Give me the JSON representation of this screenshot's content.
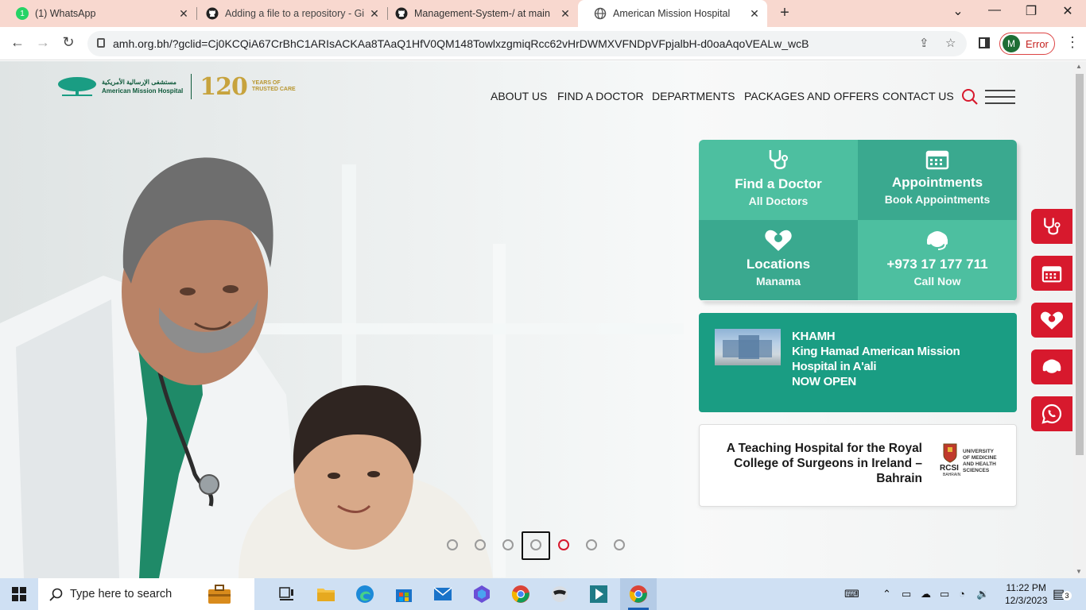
{
  "browser": {
    "tabs": [
      {
        "title": "(1) WhatsApp",
        "icon": "whatsapp-icon"
      },
      {
        "title": "Adding a file to a repository - Gi",
        "icon": "github-icon"
      },
      {
        "title": "Management-System-/ at main",
        "icon": "github-icon"
      },
      {
        "title": "American Mission Hospital",
        "icon": "globe-icon",
        "active": true
      }
    ],
    "new_tab": "+",
    "url": "amh.org.bh/?gclid=Cj0KCQiA67CrBhC1ARIsACKAa8TAaQ1HfV0QM148TowlxzgmiqRcc62vHrDWMXVFNDpVFpjalbH-d0oaAqoVEALw_wcB",
    "profile_initial": "M",
    "profile_status": "Error"
  },
  "site": {
    "logo": {
      "arabic": "مستشفى الإرسالية الأمريكية",
      "english": "American Mission Hospital",
      "anniversary": "120",
      "years_line1": "YEARS OF",
      "years_line2": "TRUSTED CARE"
    },
    "nav": [
      "ABOUT US",
      "FIND A DOCTOR",
      "DEPARTMENTS",
      "PACKAGES AND OFFERS",
      "CONTACT US"
    ],
    "quick_links": [
      {
        "title": "Find a Doctor",
        "sub": "All Doctors",
        "icon": "stethoscope-icon"
      },
      {
        "title": "Appointments",
        "sub": "Book Appointments",
        "icon": "calendar-icon"
      },
      {
        "title": "Locations",
        "sub": "Manama",
        "icon": "location-heart-icon"
      },
      {
        "title": "+973 17 177 711",
        "sub": "Call Now",
        "icon": "headset-icon"
      }
    ],
    "khamh": {
      "line1": "KHAMH",
      "line2": "King Hamad American Mission",
      "line3": "Hospital in A'ali",
      "line4": "NOW OPEN"
    },
    "rcsi": {
      "text": "A Teaching Hospital for the Royal College of Surgeons in Ireland – Bahrain",
      "logo_mark": "RCSI",
      "logo_sub": "BAHRAIN",
      "logo_line1": "UNIVERSITY",
      "logo_line2": "OF MEDICINE",
      "logo_line3": "AND HEALTH",
      "logo_line4": "SCIENCES"
    },
    "slider": {
      "count": 7,
      "active_index": 4,
      "focused_index": 3
    },
    "colors": {
      "brand_green": "#1a9d83",
      "accent_red": "#d7192d",
      "tile_light": "#4dbfa0",
      "tile_dark": "#3aa98f"
    }
  },
  "taskbar": {
    "search_placeholder": "Type here to search",
    "time": "11:22 PM",
    "date": "12/3/2023",
    "notifications": "3"
  }
}
